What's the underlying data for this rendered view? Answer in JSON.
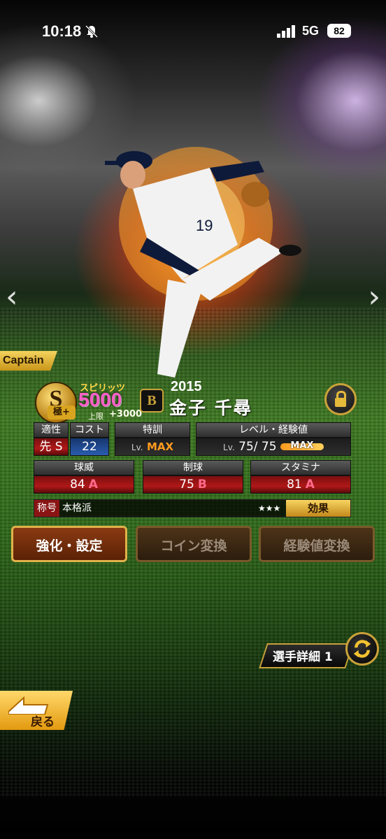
{
  "status_bar": {
    "time": "10:18",
    "network": "5G",
    "battery": "82"
  },
  "card": {
    "badge": "Captain",
    "rank_letter": "S",
    "rank_sub": "極+",
    "spirits_label": "スピリッツ",
    "spirits_value": "5000",
    "spirits_cap_label": "上限",
    "spirits_cap": "+3000",
    "team_logo": "B",
    "year": "2015",
    "player_name": "金子 千尋"
  },
  "stats": {
    "aptitude_label": "適性",
    "aptitude_value": "先 S",
    "cost_label": "コスト",
    "cost_value": "22",
    "training_label": "特訓",
    "training_lv": "Lv.",
    "training_value": "MAX",
    "level_label": "レベル・経験値",
    "level_lv": "Lv.",
    "level_value": "75/ 75",
    "exp_value": "MAX",
    "velocity_label": "球威",
    "velocity_value": "84",
    "velocity_grade": "A",
    "control_label": "制球",
    "control_value": "75",
    "control_grade": "B",
    "stamina_label": "スタミナ",
    "stamina_value": "81",
    "stamina_grade": "A"
  },
  "title": {
    "key": "称号",
    "value": "本格派",
    "stars": "★★★",
    "effect_label": "効果"
  },
  "actions": {
    "enhance": "強化・設定",
    "coin": "コイン変換",
    "exp": "経験値変換"
  },
  "detail": {
    "label": "選手詳細 1"
  },
  "back": {
    "label": "戻る"
  }
}
